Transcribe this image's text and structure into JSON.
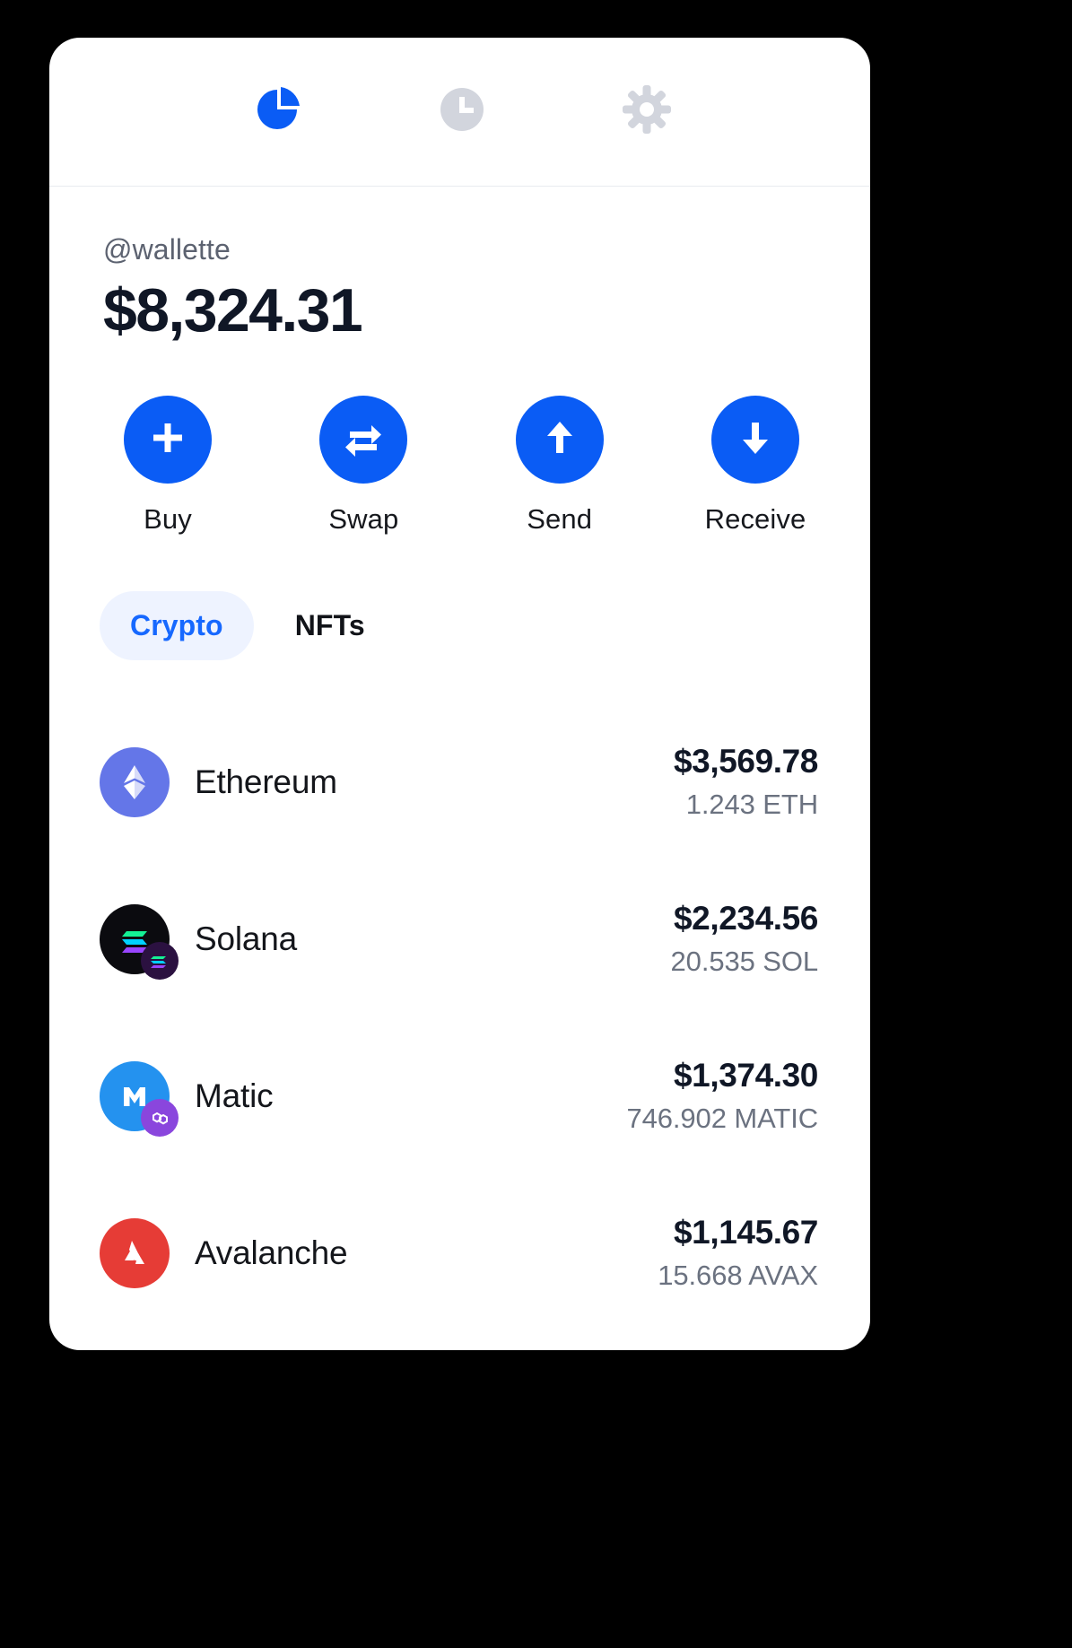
{
  "theme": {
    "page_background": "#000000",
    "card_background": "#ffffff",
    "accent_blue": "#0a5cf5",
    "tab_active_blue": "#1668ff",
    "tab_active_pill": "#eef3ff",
    "muted_gray": "#6b7280",
    "icon_inactive_gray": "#d2d5dd"
  },
  "topnav": {
    "items": [
      {
        "icon": "pie-chart-icon",
        "state": "active"
      },
      {
        "icon": "clock-icon",
        "state": "inactive"
      },
      {
        "icon": "gear-icon",
        "state": "inactive"
      }
    ]
  },
  "account": {
    "handle": "@wallette",
    "balance": "$8,324.31"
  },
  "actions": [
    {
      "icon": "plus-icon",
      "label": "Buy"
    },
    {
      "icon": "swap-icon",
      "label": "Swap"
    },
    {
      "icon": "arrow-up-icon",
      "label": "Send"
    },
    {
      "icon": "arrow-down-icon",
      "label": "Receive"
    }
  ],
  "tabs": [
    {
      "label": "Crypto",
      "active": true
    },
    {
      "label": "NFTs",
      "active": false
    }
  ],
  "tokens": [
    {
      "name": "Ethereum",
      "fiat": "$3,569.78",
      "amount": "1.243 ETH",
      "logo": "ethereum-logo",
      "logo_color": "#6476e8"
    },
    {
      "name": "Solana",
      "fiat": "$2,234.56",
      "amount": "20.535 SOL",
      "logo": "solana-logo",
      "logo_color": "#0b0b0f"
    },
    {
      "name": "Matic",
      "fiat": "$1,374.30",
      "amount": "746.902 MATIC",
      "logo": "matic-logo",
      "logo_color": "#2492ef",
      "badge": "polygon-badge",
      "badge_color": "#8a46dd"
    },
    {
      "name": "Avalanche",
      "fiat": "$1,145.67",
      "amount": "15.668 AVAX",
      "logo": "avalanche-logo",
      "logo_color": "#e63c36"
    }
  ]
}
